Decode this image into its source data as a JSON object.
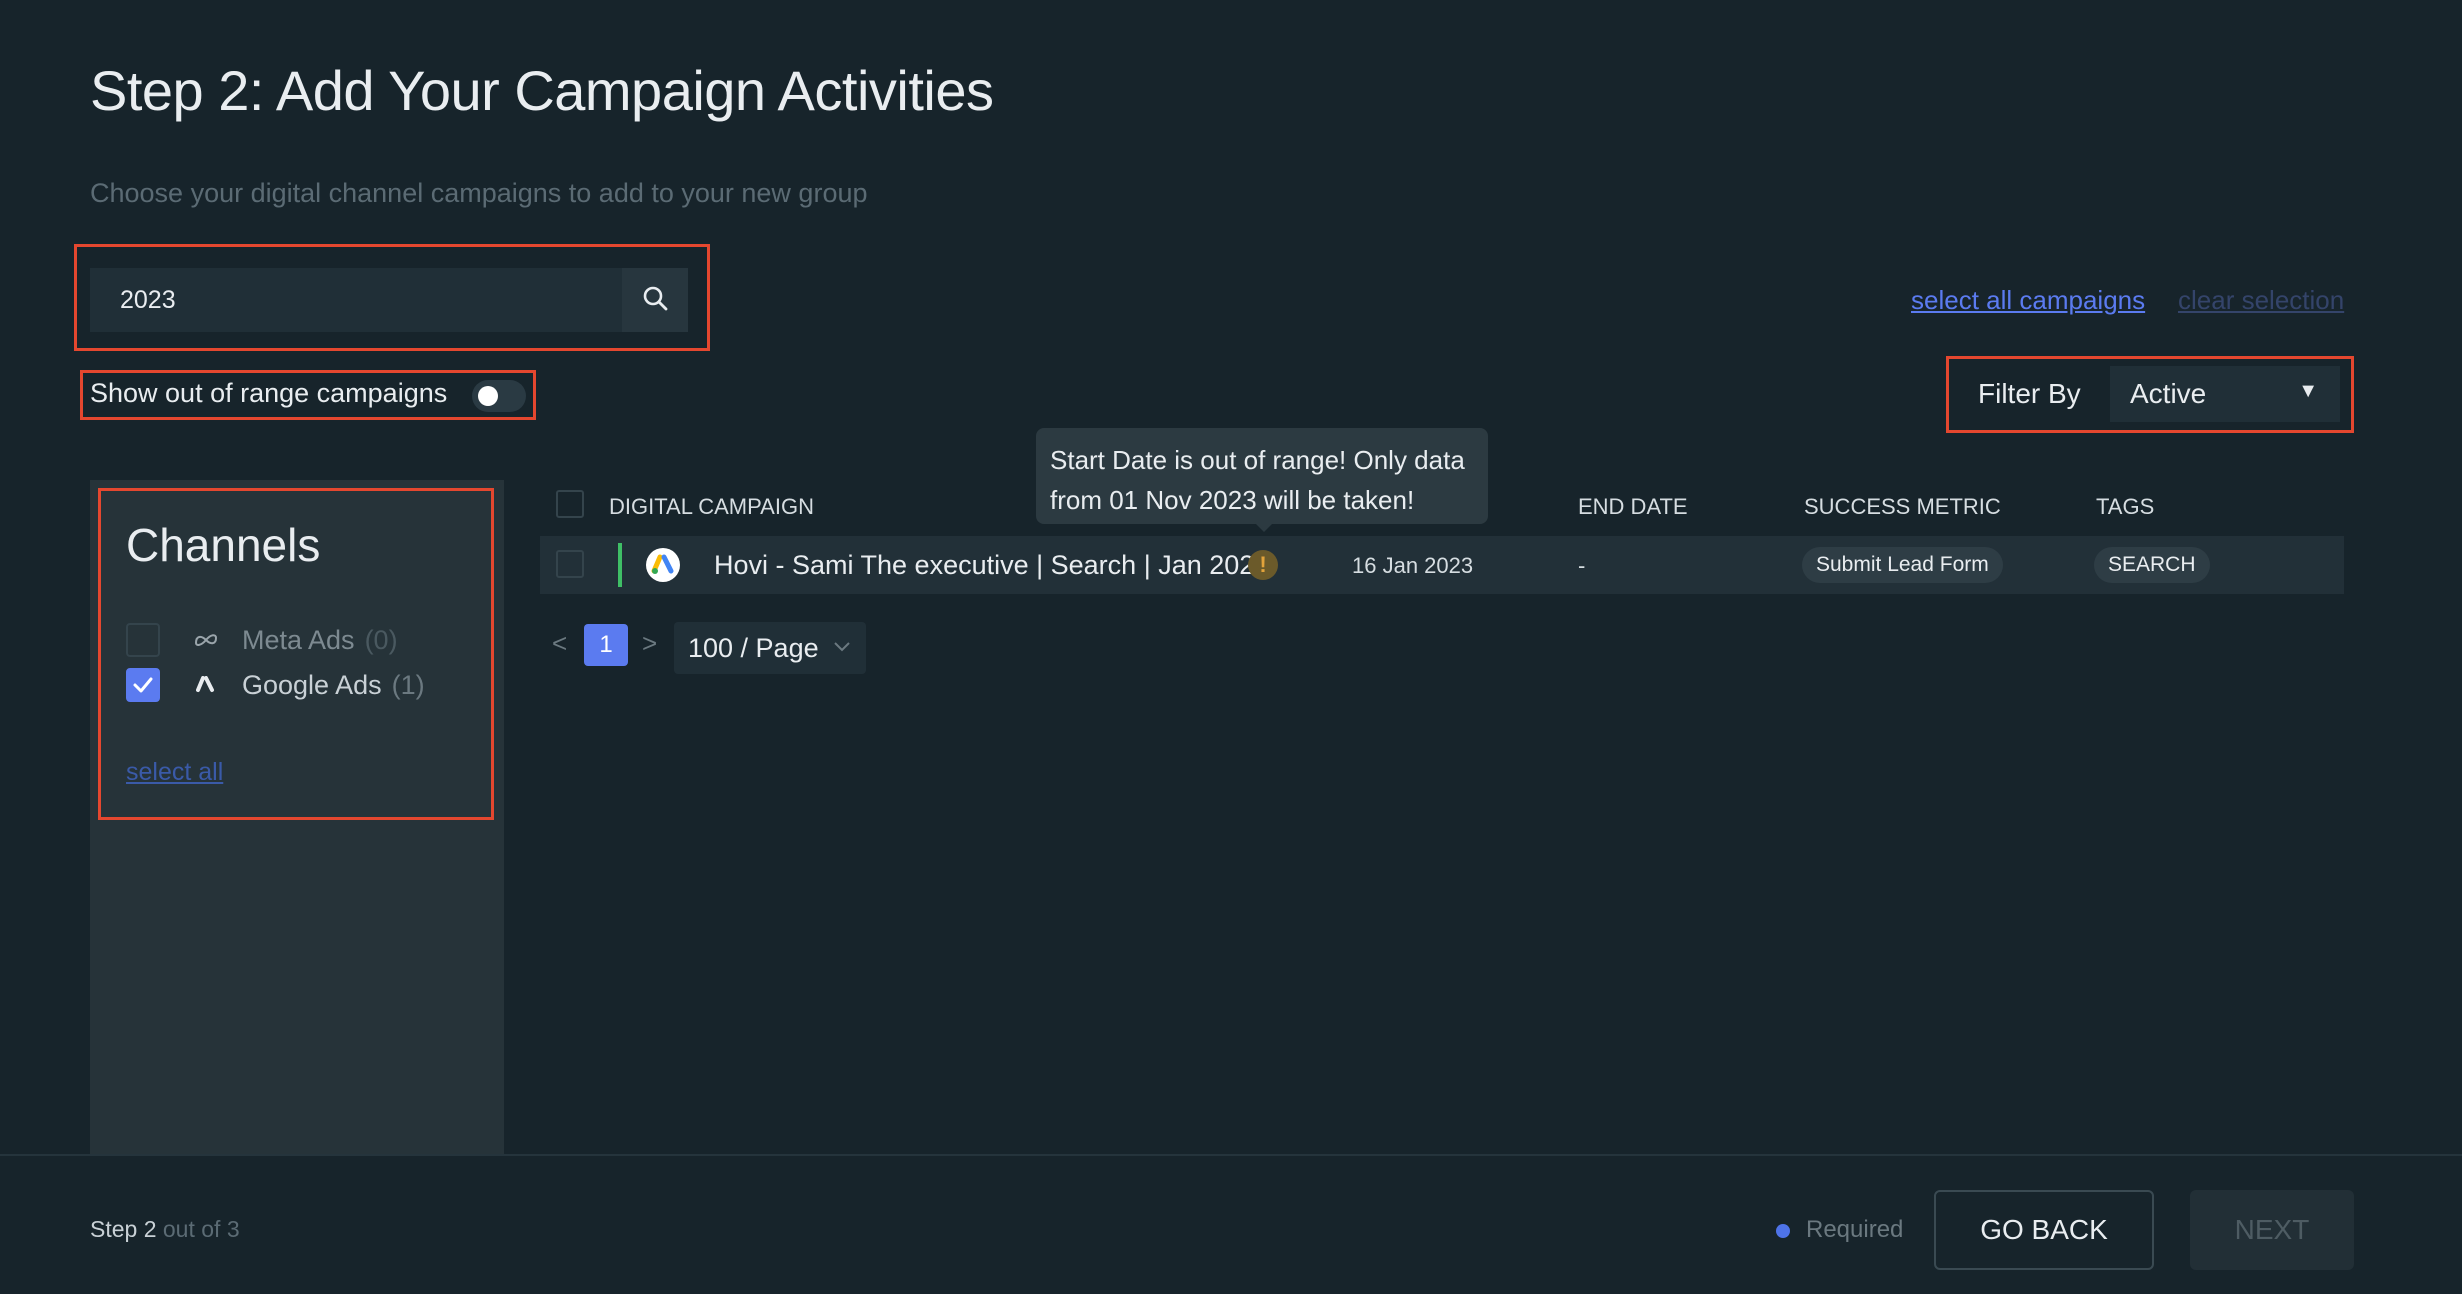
{
  "header": {
    "title": "Step 2: Add Your Campaign Activities",
    "subtitle": "Choose your digital channel campaigns to add to your new group"
  },
  "search": {
    "value": "2023",
    "icon": "search-icon"
  },
  "links": {
    "select_all_campaigns": "select all campaigns",
    "clear_selection": "clear selection"
  },
  "toggle": {
    "label": "Show out of range campaigns",
    "on": false
  },
  "filter": {
    "label": "Filter By",
    "selected": "Active"
  },
  "sidebar": {
    "title": "Channels",
    "channels": [
      {
        "name": "Meta Ads",
        "count": "(0)",
        "checked": false,
        "icon": "meta-icon"
      },
      {
        "name": "Google Ads",
        "count": "(1)",
        "checked": true,
        "icon": "google-ads-icon"
      }
    ],
    "select_all": "select all"
  },
  "table": {
    "headers": [
      "DIGITAL CAMPAIGN",
      "END DATE",
      "SUCCESS METRIC",
      "TAGS"
    ],
    "rows": [
      {
        "name": "Hovi - Sami The executive | Search | Jan 2023",
        "start_date": "16 Jan 2023",
        "end_date": "-",
        "success_metric": "Submit Lead Form",
        "tag": "SEARCH",
        "status_color": "#3fbf66"
      }
    ]
  },
  "tooltip": {
    "line1": "Start Date is out of range! Only data",
    "line2": "from 01 Nov 2023 will be taken!"
  },
  "pagination": {
    "prev": "<",
    "current_page": "1",
    "next": ">",
    "page_size": "100 / Page"
  },
  "footer": {
    "step_current": "Step 2",
    "step_total": " out of 3",
    "required_label": "Required",
    "go_back": "GO BACK",
    "next": "NEXT"
  },
  "colors": {
    "background": "#17242b",
    "accent": "#5b7bf0",
    "highlight_border": "#e4472f",
    "warning": "#e2a33b"
  }
}
